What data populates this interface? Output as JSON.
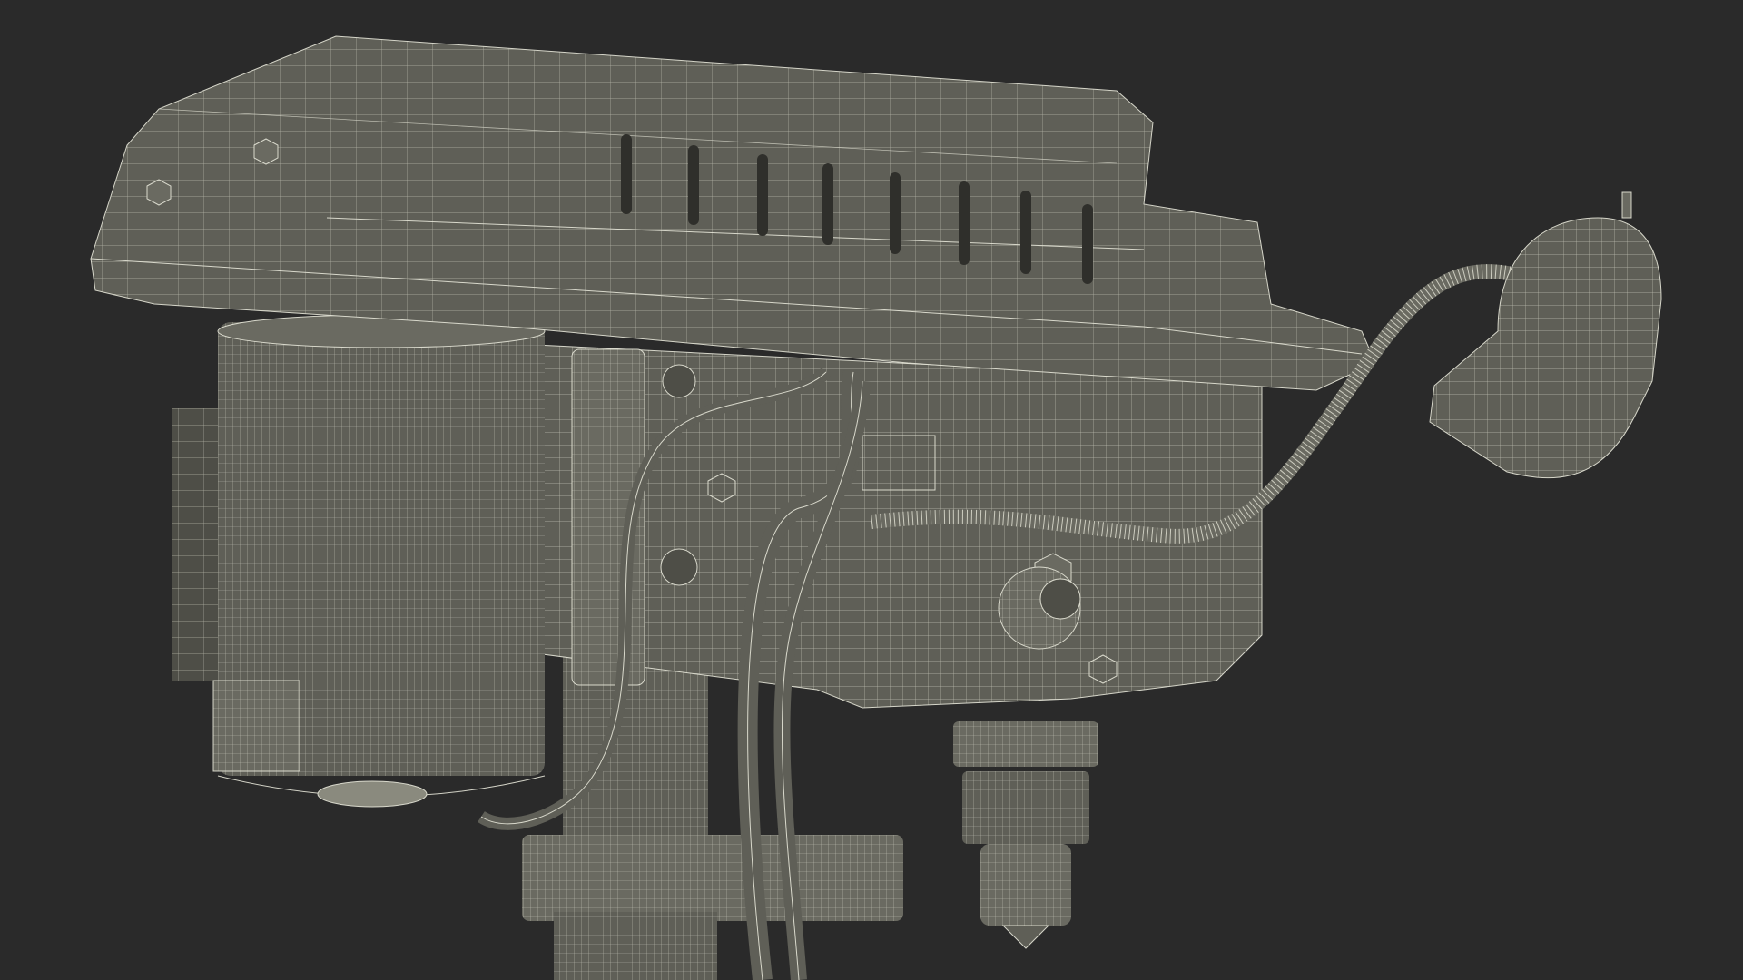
{
  "scene": {
    "background_color": "#2a2a2a",
    "object_color": "#5f5f57",
    "wire_color": "#e6e6d8",
    "parts": [
      "motor-housing-top",
      "motor",
      "motor-terminal-box",
      "spindle-head",
      "column",
      "drill-chuck",
      "power-cables",
      "work-lamp",
      "gooseneck-lamp-arm",
      "feed-handle-hub"
    ]
  }
}
